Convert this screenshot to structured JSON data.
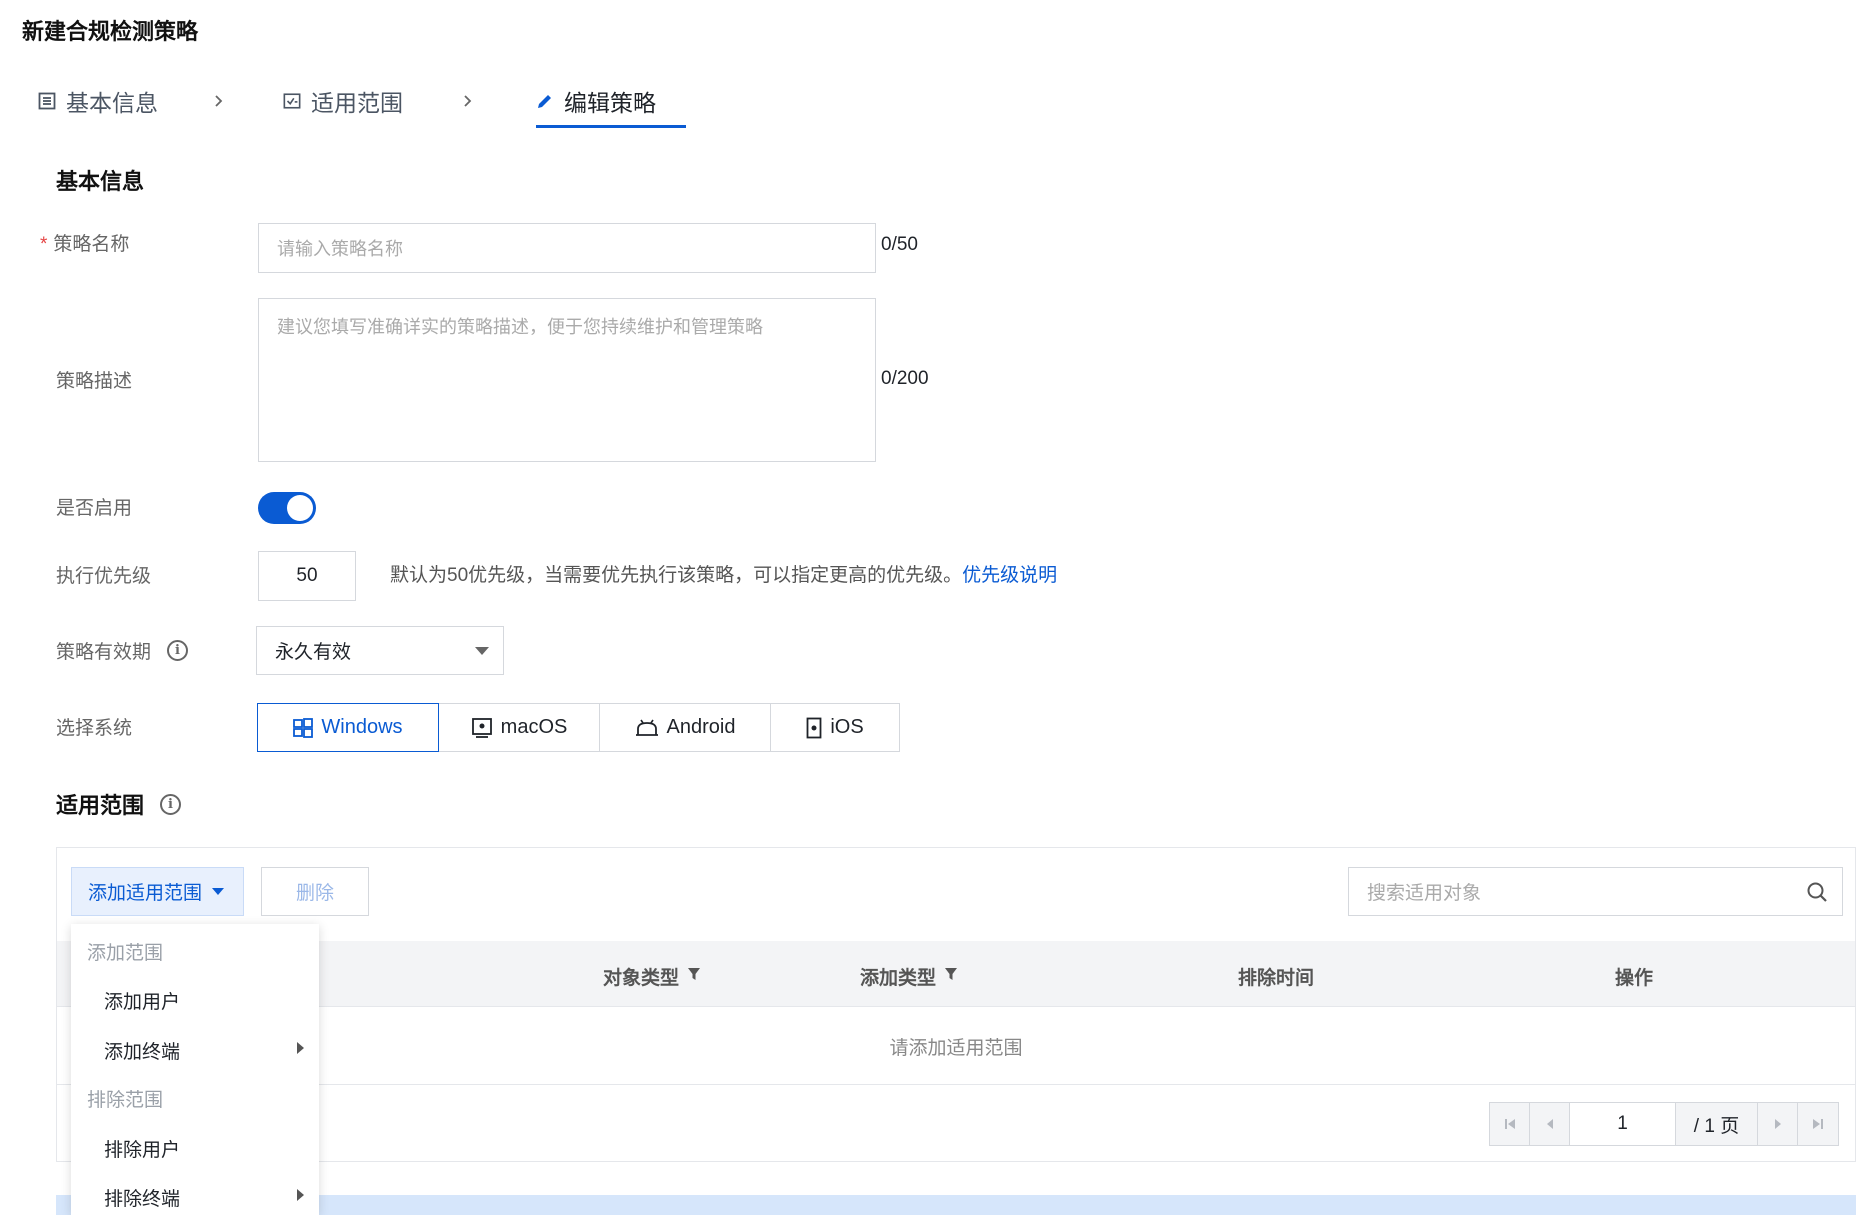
{
  "page": {
    "title": "新建合规检测策略"
  },
  "steps": [
    {
      "label": "基本信息",
      "icon": "list-icon"
    },
    {
      "label": "适用范围",
      "icon": "checklist-icon"
    },
    {
      "label": "编辑策略",
      "icon": "pencil-icon",
      "active": true
    }
  ],
  "basic": {
    "title": "基本信息",
    "name_label": "策略名称",
    "name_required_mark": "*",
    "name_placeholder": "请输入策略名称",
    "name_counter": "0/50",
    "desc_label": "策略描述",
    "desc_placeholder": "建议您填写准确详实的策略描述，便于您持续维护和管理策略",
    "desc_counter": "0/200",
    "enable_label": "是否启用",
    "enable_value": true,
    "priority_label": "执行优先级",
    "priority_value": "50",
    "priority_help": "默认为50优先级，当需要优先执行该策略，可以指定更高的优先级。",
    "priority_link": "优先级说明",
    "validity_label": "策略有效期",
    "validity_value": "永久有效",
    "system_label": "选择系统",
    "systems": [
      {
        "label": "Windows",
        "icon": "windows-icon",
        "active": true
      },
      {
        "label": "macOS",
        "icon": "mac-icon"
      },
      {
        "label": "Android",
        "icon": "android-icon"
      },
      {
        "label": "iOS",
        "icon": "ios-icon"
      }
    ]
  },
  "scope": {
    "title": "适用范围",
    "add_button": "添加适用范围",
    "delete_button": "删除",
    "search_placeholder": "搜索适用对象",
    "columns": [
      "对象类型",
      "添加类型",
      "排除时间",
      "操作"
    ],
    "empty_text": "请添加适用范围",
    "pager": {
      "current": "1",
      "total": "/ 1 页"
    }
  },
  "dropdown": {
    "group_add": "添加范围",
    "add_user": "添加用户",
    "add_terminal": "添加终端",
    "group_exclude": "排除范围",
    "exclude_user": "排除用户",
    "exclude_terminal": "排除终端"
  },
  "colors": {
    "accent": "#0a5bd3",
    "required": "#e54545"
  }
}
